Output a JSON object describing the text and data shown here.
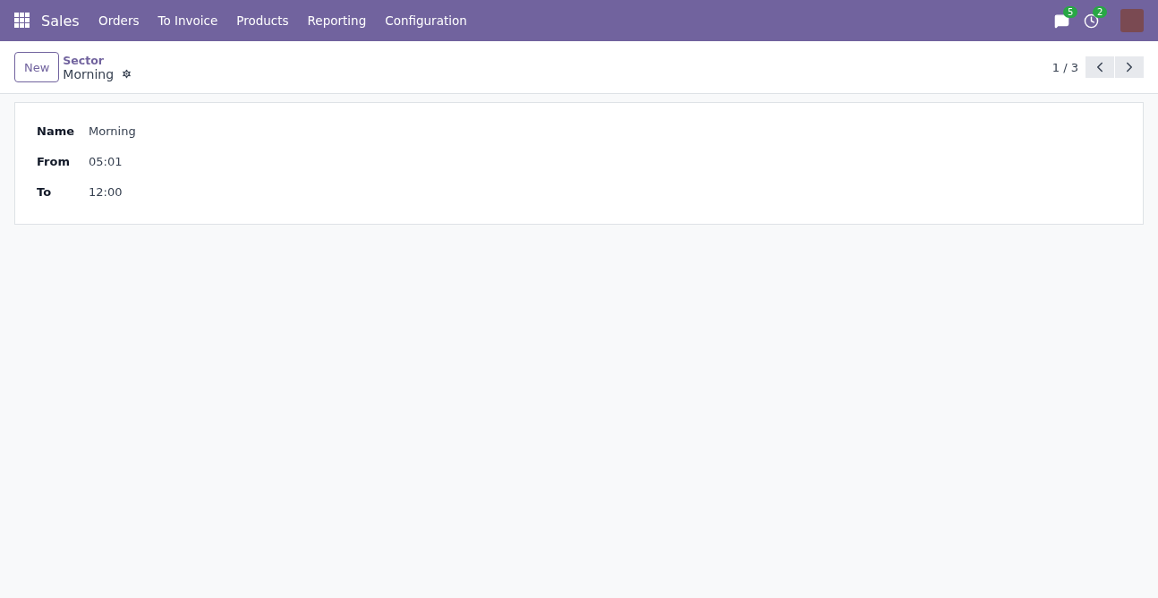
{
  "navbar": {
    "app": "Sales",
    "menu": [
      "Orders",
      "To Invoice",
      "Products",
      "Reporting",
      "Configuration"
    ],
    "messages_count": "5",
    "activities_count": "2"
  },
  "control_panel": {
    "new_button": "New",
    "breadcrumb": "Sector",
    "record_title": "Morning",
    "pager": "1 / 3"
  },
  "form": {
    "fields": [
      {
        "label": "Name",
        "value": "Morning"
      },
      {
        "label": "From",
        "value": "05:01"
      },
      {
        "label": "To",
        "value": "12:00"
      }
    ]
  }
}
